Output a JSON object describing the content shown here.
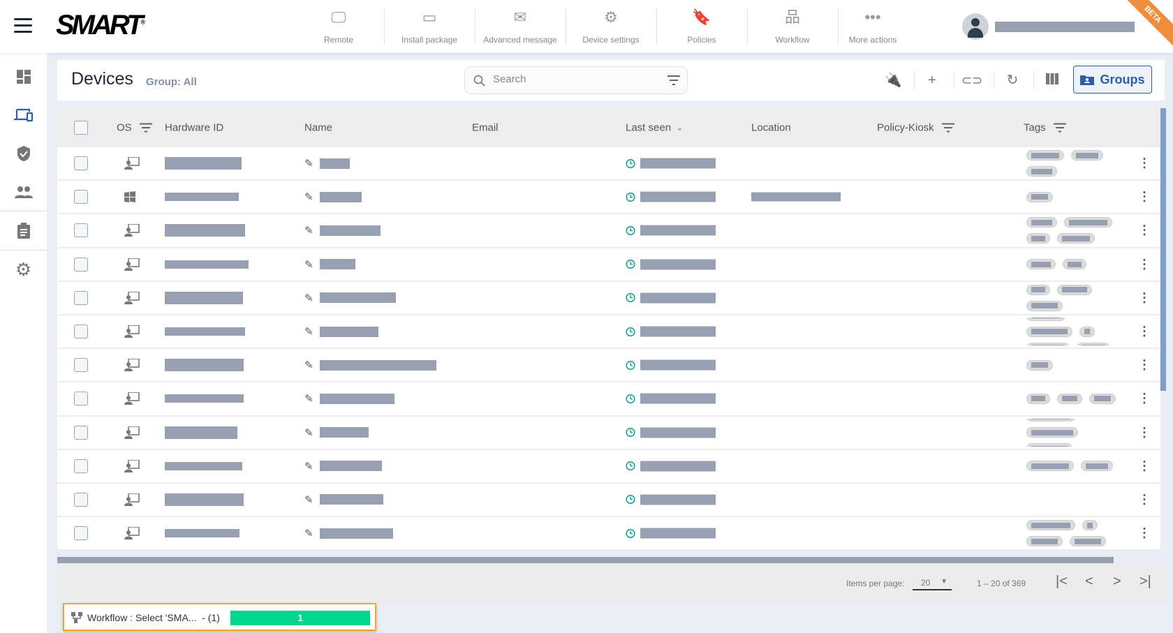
{
  "topbar": {
    "logo": "SMART",
    "badge": "BETA",
    "actions": [
      {
        "label": "Remote",
        "icon": "monitor-icon"
      },
      {
        "label": "Install package",
        "icon": "package-icon"
      },
      {
        "label": "Advanced message",
        "icon": "envelope-icon"
      },
      {
        "label": "Device settings",
        "icon": "gear-icon"
      },
      {
        "label": "Policies",
        "icon": "bookmark-icon"
      },
      {
        "label": "Workflow",
        "icon": "workflow-icon"
      },
      {
        "label": "More actions",
        "icon": "more-icon"
      }
    ]
  },
  "sidebar": {
    "items": [
      {
        "icon": "dashboard-icon"
      },
      {
        "icon": "devices-icon",
        "active": true
      },
      {
        "icon": "shield-icon"
      },
      {
        "icon": "users-icon"
      },
      {
        "icon": "clipboard-icon"
      },
      {
        "icon": "settings-icon"
      }
    ]
  },
  "header": {
    "title": "Devices",
    "group": "Group: All",
    "search_placeholder": "Search",
    "groups_label": "Groups"
  },
  "table": {
    "columns": [
      "OS",
      "Hardware ID",
      "Name",
      "Email",
      "Last seen",
      "Location",
      "Policy-Kiosk",
      "Tags"
    ],
    "rows": [
      {
        "os": "kiosk"
      },
      {
        "os": "windows"
      },
      {
        "os": "kiosk"
      },
      {
        "os": "kiosk"
      },
      {
        "os": "kiosk"
      },
      {
        "os": "kiosk"
      },
      {
        "os": "kiosk"
      },
      {
        "os": "kiosk"
      },
      {
        "os": "kiosk"
      },
      {
        "os": "kiosk"
      },
      {
        "os": "kiosk"
      },
      {
        "os": "kiosk"
      }
    ]
  },
  "footer": {
    "items_per_page_label": "Items per page:",
    "items_per_page": "20",
    "range": "1 – 20 of 369"
  },
  "toast": {
    "text": "Workflow : Select 'SMA...  - (1)",
    "progress_label": "1",
    "progress": 1.0
  },
  "colors": {
    "accent": "#2a5ea8",
    "progress": "#00d68f",
    "clock": "#1aa39a",
    "beta": "#f08c3c"
  }
}
